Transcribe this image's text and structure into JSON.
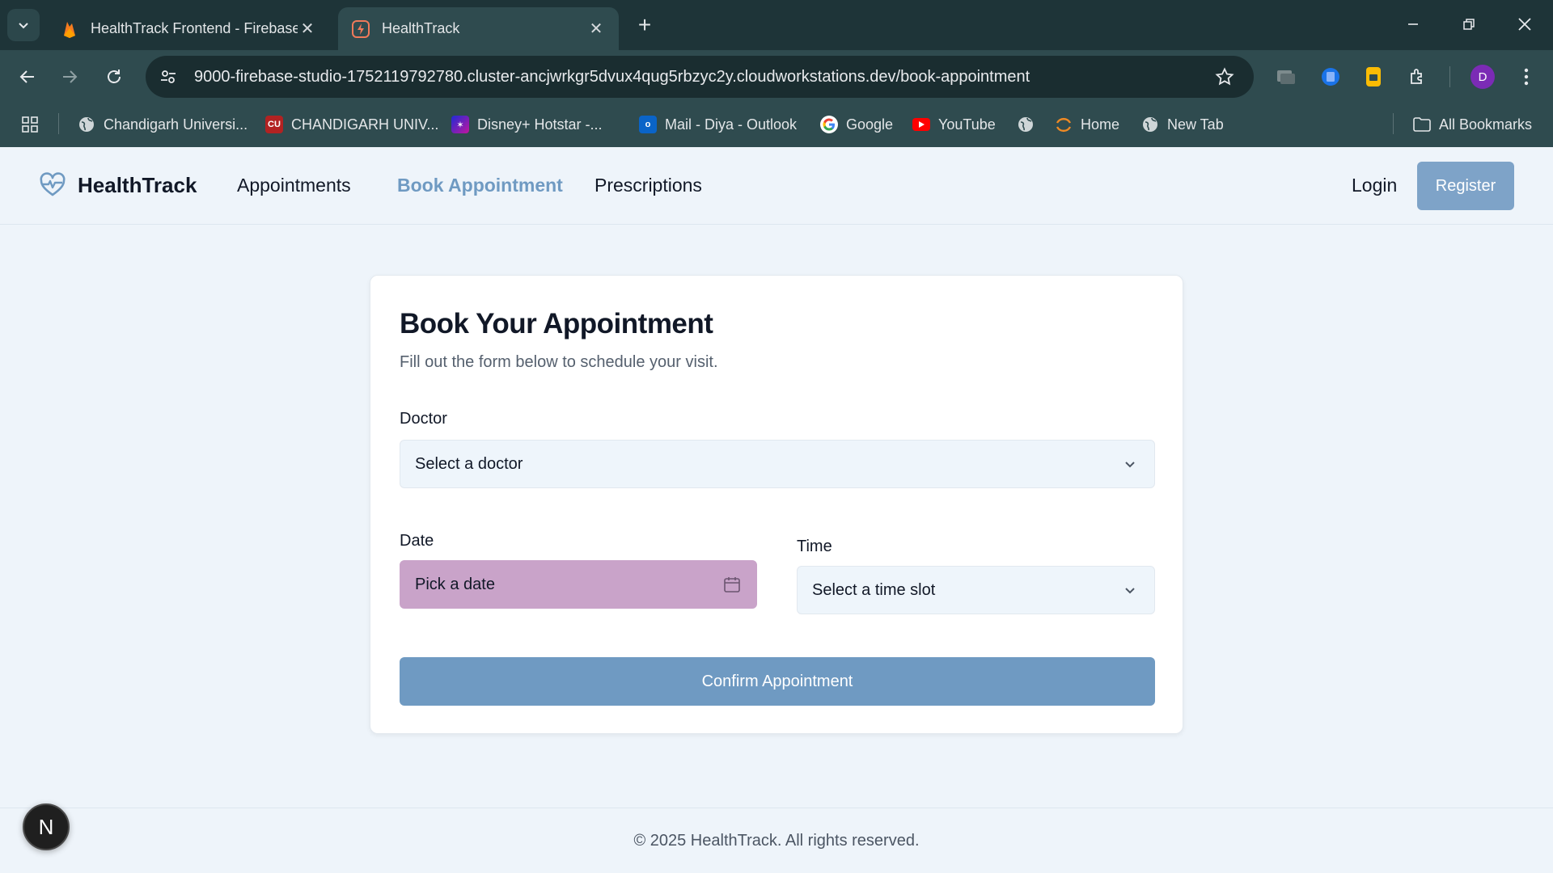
{
  "browser": {
    "tabs": [
      {
        "title": "HealthTrack Frontend - Firebase Studio",
        "active": false
      },
      {
        "title": "HealthTrack",
        "active": true
      }
    ],
    "url": "9000-firebase-studio-1752119792780.cluster-ancjwrkgr5dvux4qug5rbzyc2y.cloudworkstations.dev/book-appointment",
    "profile_initial": "D",
    "bookmarks": [
      {
        "label": "Chandigarh Universi...",
        "icon": "globe-icon"
      },
      {
        "label": "CHANDIGARH UNIV...",
        "icon": "cu-logo-icon"
      },
      {
        "label": "Disney+ Hotstar -...",
        "icon": "hotstar-icon"
      },
      {
        "label": "Mail - Diya - Outlook",
        "icon": "outlook-icon"
      },
      {
        "label": "Google",
        "icon": "google-icon"
      },
      {
        "label": "YouTube",
        "icon": "youtube-icon"
      },
      {
        "label": "",
        "icon": "globe-icon"
      },
      {
        "label": "Home",
        "icon": "home-arc-icon"
      },
      {
        "label": "New Tab",
        "icon": "globe-icon"
      }
    ],
    "all_bookmarks": "All Bookmarks"
  },
  "app": {
    "brand": "HealthTrack",
    "nav": {
      "appointments": "Appointments",
      "book_appointment": "Book Appointment",
      "prescriptions": "Prescriptions"
    },
    "login": "Login",
    "register": "Register"
  },
  "form": {
    "title": "Book Your Appointment",
    "subtitle": "Fill out the form below to schedule your visit.",
    "doctor_label": "Doctor",
    "doctor_placeholder": "Select a doctor",
    "date_label": "Date",
    "date_placeholder": "Pick a date",
    "time_label": "Time",
    "time_placeholder": "Select a time slot",
    "submit": "Confirm Appointment"
  },
  "footer": {
    "text": "© 2025 HealthTrack. All rights reserved."
  },
  "dev_badge": "N",
  "colors": {
    "accent": "#6f9ac2",
    "register_bg": "#7ea3c8",
    "date_field_bg": "#c9a3c9",
    "page_bg": "#eef4fa"
  }
}
